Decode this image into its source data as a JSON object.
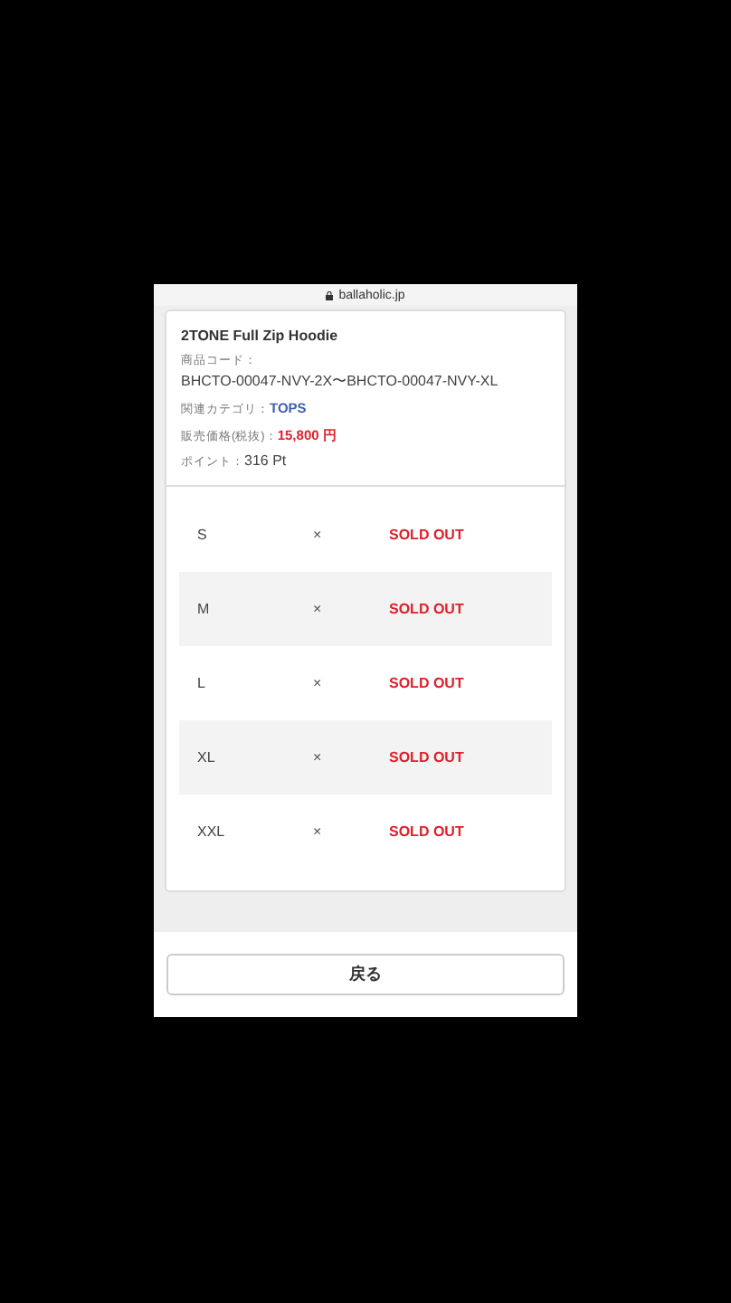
{
  "browser": {
    "url": "ballaholic.jp"
  },
  "product": {
    "name": "2TONE Full Zip Hoodie",
    "fields": [
      {
        "label": "商品コード：",
        "value": "BHCTO-00047-NVY-2X〜BHCTO-00047-NVY-XL",
        "kind": "plain"
      },
      {
        "label": "関連カテゴリ：",
        "value": "TOPS",
        "kind": "link"
      },
      {
        "label": "販売価格(税抜)：",
        "value": "15,800 円",
        "kind": "price"
      },
      {
        "label": "ポイント：",
        "value": "316 Pt",
        "kind": "plain"
      }
    ]
  },
  "stock": [
    {
      "size": "S",
      "mark": "×",
      "status": "SOLD OUT"
    },
    {
      "size": "M",
      "mark": "×",
      "status": "SOLD OUT"
    },
    {
      "size": "L",
      "mark": "×",
      "status": "SOLD OUT"
    },
    {
      "size": "XL",
      "mark": "×",
      "status": "SOLD OUT"
    },
    {
      "size": "XXL",
      "mark": "×",
      "status": "SOLD OUT"
    }
  ],
  "back_button": "戻る"
}
